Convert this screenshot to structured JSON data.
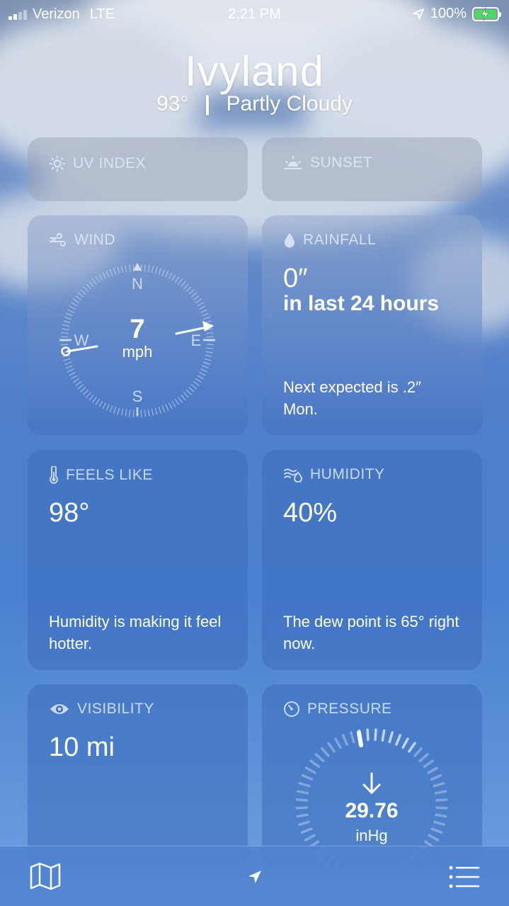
{
  "status_bar": {
    "carrier": "Verizon",
    "network": "LTE",
    "time": "2:21 PM",
    "battery": "100%"
  },
  "header": {
    "city": "Ivyland",
    "temperature": "93°",
    "separator": "|",
    "condition": "Partly Cloudy"
  },
  "cards": {
    "uv_index": {
      "title": "UV INDEX"
    },
    "sunset": {
      "title": "SUNSET"
    },
    "wind": {
      "title": "WIND",
      "speed": "7",
      "unit": "mph",
      "compass": {
        "n": "N",
        "s": "S",
        "e": "E",
        "w": "W"
      }
    },
    "rainfall": {
      "title": "RAINFALL",
      "amount": "0″",
      "period": "in last 24 hours",
      "description": "Next expected is .2″ Mon."
    },
    "feels_like": {
      "title": "FEELS LIKE",
      "value": "98°",
      "description": "Humidity is making it feel hotter."
    },
    "humidity": {
      "title": "HUMIDITY",
      "value": "40%",
      "description": "The dew point is 65° right now."
    },
    "visibility": {
      "title": "VISIBILITY",
      "value": "10 mi"
    },
    "pressure": {
      "title": "PRESSURE",
      "value": "29.76",
      "unit": "inHg"
    }
  },
  "tab_bar": {
    "items": [
      "map-icon",
      "location-arrow-icon",
      "list-icon"
    ]
  }
}
